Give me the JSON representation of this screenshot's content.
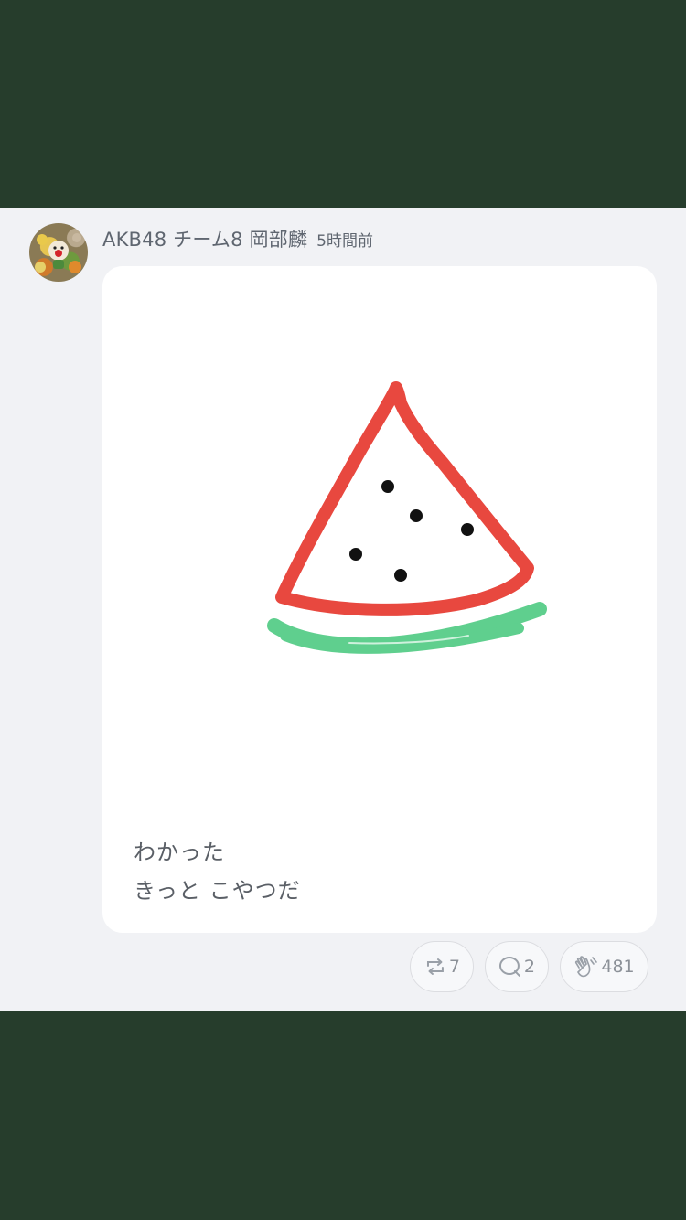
{
  "post": {
    "author": "AKB48 チーム8 岡部麟",
    "time": "5時間前",
    "avatar_icon": "avatar-photo",
    "body_lines": [
      "わかった",
      "きっと こやつだ"
    ],
    "drawing": {
      "subject": "watermelon-slice",
      "colors": {
        "rind_outline": "#e8483f",
        "rind_green": "#5fcf8e",
        "seeds": "#111111"
      }
    },
    "actions": {
      "repost": {
        "icon": "repost-icon",
        "count": "7"
      },
      "reply": {
        "icon": "speech-bubble-icon",
        "count": "2"
      },
      "clap": {
        "icon": "clap-hands-icon",
        "count": "481"
      }
    }
  },
  "colors": {
    "frame": "#263d2c",
    "background": "#f1f2f5",
    "card": "#ffffff",
    "text": "#5f6670"
  }
}
